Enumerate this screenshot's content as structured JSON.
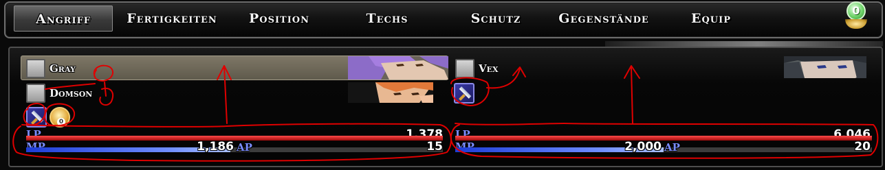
{
  "menu": {
    "tabs": [
      {
        "label": "Angriff",
        "active": true
      },
      {
        "label": "Fertigkeiten",
        "active": false
      },
      {
        "label": "Position",
        "active": false
      },
      {
        "label": "Techs",
        "active": false
      },
      {
        "label": "Schutz",
        "active": false
      },
      {
        "label": "Gegenstände",
        "active": false
      },
      {
        "label": "Equip",
        "active": false
      }
    ],
    "badge_value": "0"
  },
  "party_left": {
    "members": [
      {
        "name": "Gray",
        "selected": true
      },
      {
        "name": "Domson",
        "selected": false
      }
    ],
    "status_icons": [
      "sword-icon",
      "gold-orb-icon"
    ],
    "gold_orb_value": "0",
    "stats": {
      "lp_label": "LP",
      "lp_value": "1,378",
      "lp_fraction": 1.0,
      "mp_label": "MP",
      "mp_value": "1,186",
      "mp_fraction": 0.49,
      "ap_label": "AP",
      "ap_value": "15"
    }
  },
  "party_right": {
    "members": [
      {
        "name": "Vex",
        "selected": false
      }
    ],
    "status_icons": [
      "sword-icon"
    ],
    "stats": {
      "lp_label": "LP",
      "lp_value": "6,046",
      "lp_fraction": 1.0,
      "mp_label": "MP",
      "mp_value": "2,000",
      "mp_fraction": 0.5,
      "ap_label": "AP",
      "ap_value": "20"
    }
  },
  "colors": {
    "lp_bar": "#d11818",
    "mp_bar": "#4f6fff",
    "annotation": "#e00000",
    "label_blue": "#7a8cff"
  }
}
